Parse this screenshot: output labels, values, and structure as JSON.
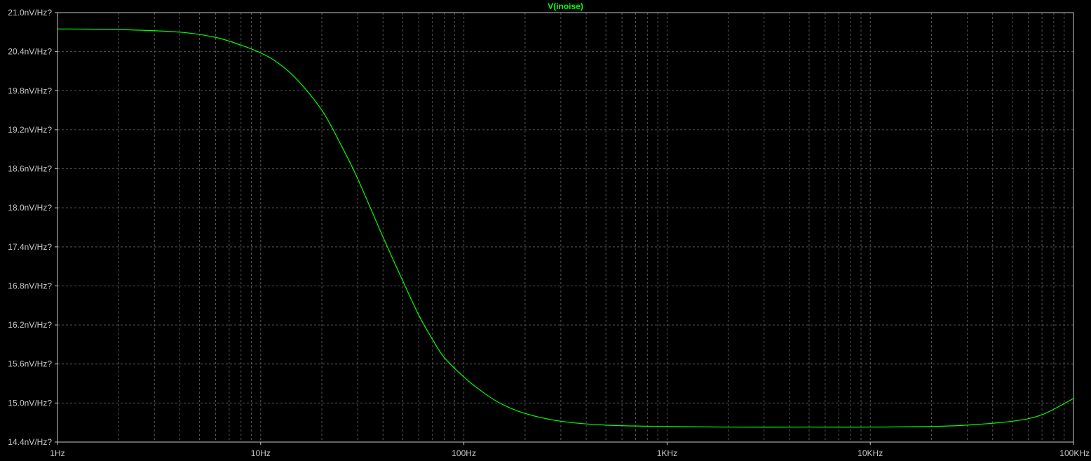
{
  "window": {
    "background_color": "#000000",
    "frame_color": "#c8c8c8",
    "grid_color": "#555555",
    "text_color": "#c8c8c8"
  },
  "chart_data": {
    "type": "line",
    "title": "",
    "xlabel": "",
    "ylabel": "",
    "x_scale": "log",
    "x_range": [
      1,
      100000
    ],
    "y_range": [
      14.4,
      21.0
    ],
    "y_unit": "nV/Hz?",
    "grid": true,
    "x_tick_labels": [
      {
        "value": 1,
        "label": "1Hz"
      },
      {
        "value": 10,
        "label": "10Hz"
      },
      {
        "value": 100,
        "label": "100Hz"
      },
      {
        "value": 1000,
        "label": "1KHz"
      },
      {
        "value": 10000,
        "label": "10KHz"
      },
      {
        "value": 100000,
        "label": "100KHz"
      }
    ],
    "y_tick_labels": [
      {
        "value": 21.0,
        "label": "21.0nV/Hz?"
      },
      {
        "value": 20.4,
        "label": "20.4nV/Hz?"
      },
      {
        "value": 19.8,
        "label": "19.8nV/Hz?"
      },
      {
        "value": 19.2,
        "label": "19.2nV/Hz?"
      },
      {
        "value": 18.6,
        "label": "18.6nV/Hz?"
      },
      {
        "value": 18.0,
        "label": "18.0nV/Hz?"
      },
      {
        "value": 17.4,
        "label": "17.4nV/Hz?"
      },
      {
        "value": 16.8,
        "label": "16.8nV/Hz?"
      },
      {
        "value": 16.2,
        "label": "16.2nV/Hz?"
      },
      {
        "value": 15.6,
        "label": "15.6nV/Hz?"
      },
      {
        "value": 15.0,
        "label": "15.0nV/Hz?"
      },
      {
        "value": 14.4,
        "label": "14.4nV/Hz?"
      }
    ],
    "series": [
      {
        "name": "V(inoise)",
        "color": "#00ff00",
        "x": [
          1,
          2,
          4,
          6,
          8,
          10,
          12,
          15,
          20,
          25,
          30,
          40,
          50,
          60,
          70,
          80,
          100,
          120,
          150,
          200,
          300,
          500,
          1000,
          2000,
          5000,
          10000,
          20000,
          30000,
          50000,
          70000,
          100000
        ],
        "y": [
          20.75,
          20.74,
          20.7,
          20.62,
          20.5,
          20.38,
          20.24,
          19.98,
          19.5,
          18.95,
          18.45,
          17.55,
          16.88,
          16.35,
          15.98,
          15.7,
          15.4,
          15.2,
          15.0,
          14.84,
          14.72,
          14.66,
          14.64,
          14.63,
          14.63,
          14.63,
          14.64,
          14.66,
          14.72,
          14.82,
          15.07
        ]
      }
    ]
  }
}
